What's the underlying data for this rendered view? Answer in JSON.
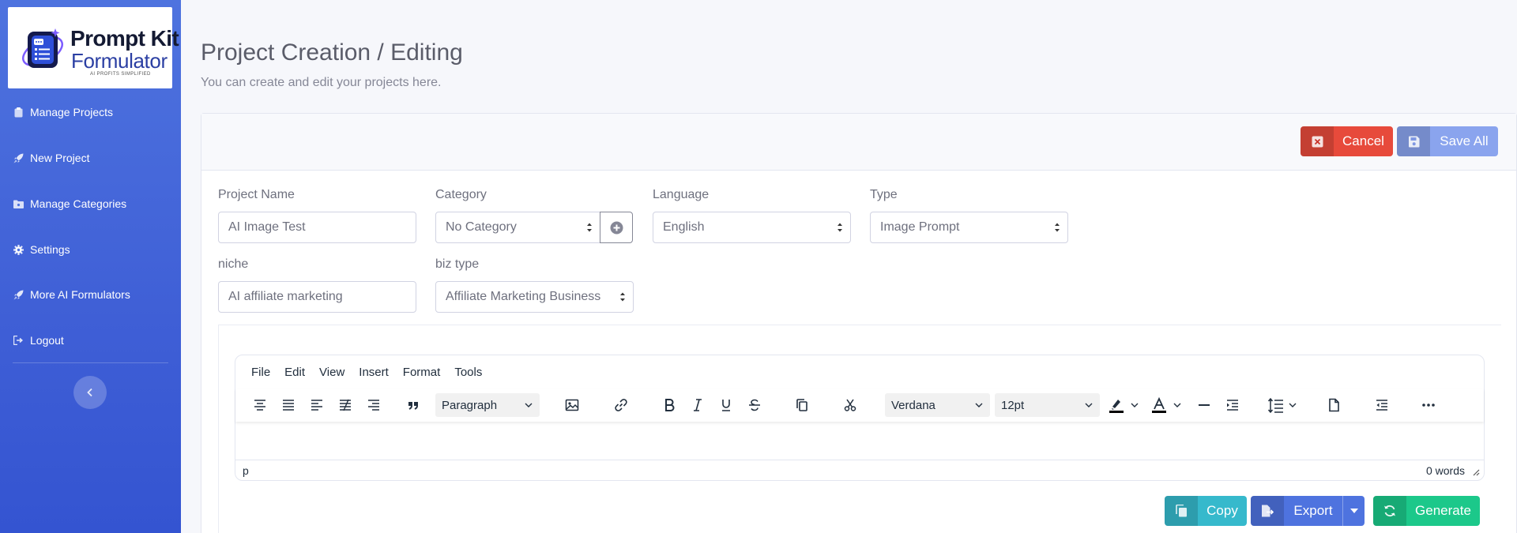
{
  "logo": {
    "line1": "Prompt Kit",
    "line2": "Formulator",
    "tagline": "AI PROFITS SIMPLIFIED"
  },
  "sidebar": {
    "items": [
      {
        "label": "Manage Projects",
        "icon": "clipboard-icon"
      },
      {
        "label": "New Project",
        "icon": "rocket-icon"
      },
      {
        "label": "Manage Categories",
        "icon": "folder-icon"
      },
      {
        "label": "Settings",
        "icon": "gear-icon"
      },
      {
        "label": "More AI Formulators",
        "icon": "rocket-icon"
      },
      {
        "label": "Logout",
        "icon": "logout-icon"
      }
    ],
    "toggle_icon": "chevron-left-icon"
  },
  "header": {
    "title": "Project Creation / Editing",
    "subtitle": "You can create and edit your projects here."
  },
  "actions": {
    "cancel_label": "Cancel",
    "save_label": "Save All"
  },
  "form": {
    "project_name": {
      "label": "Project Name",
      "value": "AI Image Test"
    },
    "category": {
      "label": "Category",
      "value": "No Category"
    },
    "language": {
      "label": "Language",
      "value": "English"
    },
    "type": {
      "label": "Type",
      "value": "Image Prompt"
    },
    "niche": {
      "label": "niche",
      "value": "AI affiliate marketing"
    },
    "biz_type": {
      "label": "biz type",
      "value": "Affiliate Marketing Business"
    }
  },
  "editor": {
    "menu": [
      "File",
      "Edit",
      "View",
      "Insert",
      "Format",
      "Tools"
    ],
    "block_format": "Paragraph",
    "font_family": "Verdana",
    "font_size": "12pt",
    "status_path": "p",
    "word_count": "0 words"
  },
  "bottom_actions": {
    "copy_label": "Copy",
    "export_label": "Export",
    "generate_label": "Generate"
  },
  "colors": {
    "sidebar": "#4e73df",
    "cancel": "#e74a3b",
    "save": "#8aa4ee",
    "copy": "#36b9cc",
    "export": "#4e73df",
    "generate": "#1cc88a"
  }
}
